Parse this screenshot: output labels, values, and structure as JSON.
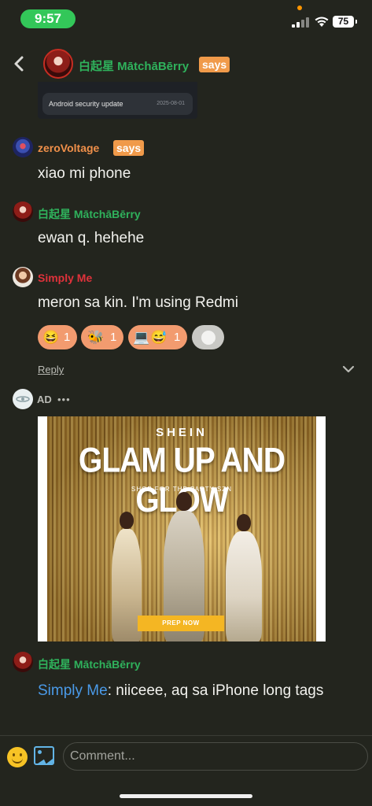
{
  "status_bar": {
    "time": "9:57",
    "battery": "75"
  },
  "header": {
    "user_name": "白起星 MātchāBērry",
    "says_badge": "says"
  },
  "prev_image": {
    "title": "Android security update",
    "date": "2025-08-01"
  },
  "comments": [
    {
      "user": "zeroVoltage",
      "badge": "says",
      "text": "xiao mi phone",
      "name_color": "#f0904a"
    },
    {
      "user": "白起星 MātchāBērry",
      "text": "ewan q. hehehe",
      "name_color": "#2fb25c"
    },
    {
      "user": "Simply Me",
      "text": "meron sa kin. I'm using Redmi",
      "name_color": "#e0323b"
    }
  ],
  "reactions": [
    {
      "emoji": "laughing-face",
      "count": "1"
    },
    {
      "emoji": "pencil-bug",
      "count": "1"
    },
    {
      "emoji": "computer-face",
      "count": "1"
    }
  ],
  "actions": {
    "reply": "Reply"
  },
  "ad": {
    "label": "AD",
    "more": "•••",
    "brand": "SHEIN",
    "headline": "GLAM UP AND GLOW",
    "tagline": "SHOP FOR THE PARTY SZN",
    "cta": "PREP NOW"
  },
  "last_comment": {
    "user": "白起星 MātchāBērry",
    "mention": "Simply Me",
    "text": ": niiceee, aq sa iPhone long tags"
  },
  "composer": {
    "placeholder": "Comment..."
  },
  "colors": {
    "accent_green": "#2fb25c",
    "badge_orange": "#f09a4a",
    "mention_blue": "#4a9ae8",
    "background": "#23251e"
  }
}
